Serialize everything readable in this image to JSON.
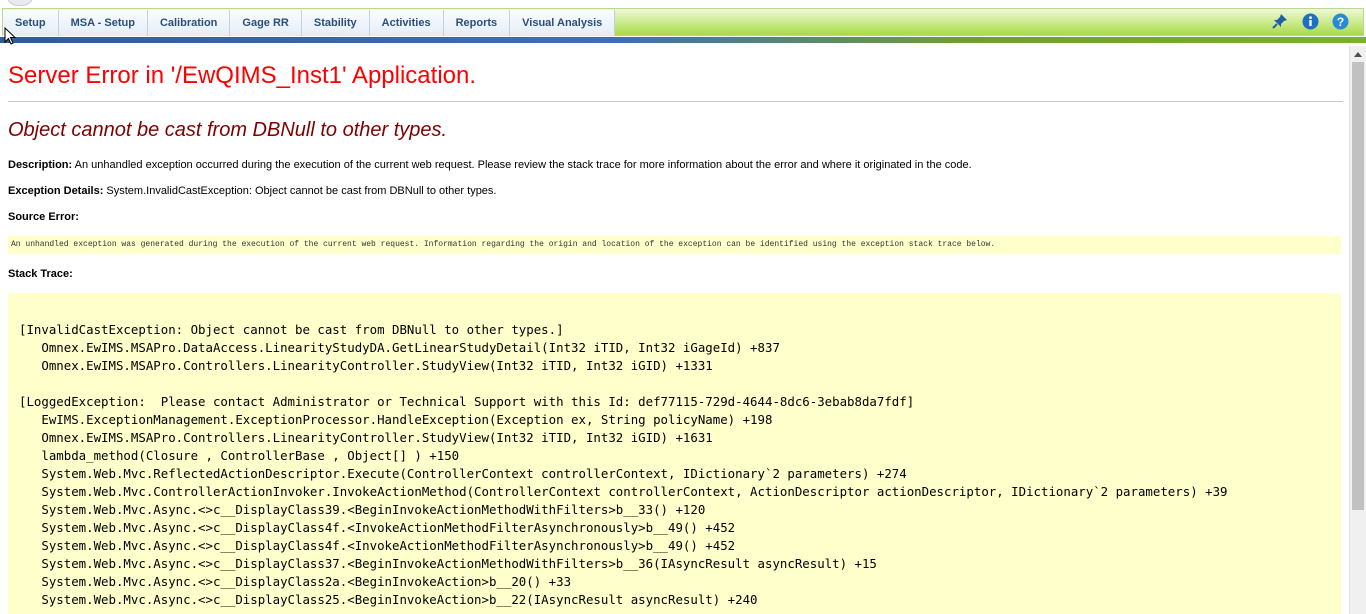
{
  "nav": {
    "tabs": [
      {
        "label": "Setup"
      },
      {
        "label": "MSA - Setup"
      },
      {
        "label": "Calibration"
      },
      {
        "label": "Gage RR"
      },
      {
        "label": "Stability"
      },
      {
        "label": "Activities"
      },
      {
        "label": "Reports"
      },
      {
        "label": "Visual Analysis"
      }
    ],
    "icons": [
      "pin-icon",
      "info-icon",
      "help-icon"
    ]
  },
  "error": {
    "title": "Server Error in '/EwQIMS_Inst1' Application.",
    "message": "Object cannot be cast from DBNull to other types.",
    "description_label": "Description:",
    "description_text": " An unhandled exception occurred during the execution of the current web request. Please review the stack trace for more information about the error and where it originated in the code.",
    "exception_label": "Exception Details:",
    "exception_text": " System.InvalidCastException: Object cannot be cast from DBNull to other types.",
    "source_error_label": "Source Error:",
    "source_error_text": "An unhandled exception was generated during the execution of the current web request. Information regarding the origin and location of the exception can be identified using the exception stack trace below.",
    "stack_trace_label": "Stack Trace:",
    "stack_trace": [
      "[InvalidCastException: Object cannot be cast from DBNull to other types.]",
      "   Omnex.EwIMS.MSAPro.DataAccess.LinearityStudyDA.GetLinearStudyDetail(Int32 iTID, Int32 iGageId) +837",
      "   Omnex.EwIMS.MSAPro.Controllers.LinearityController.StudyView(Int32 iTID, Int32 iGID) +1331",
      "",
      "[LoggedException:  Please contact Administrator or Technical Support with this Id: def77115-729d-4644-8dc6-3ebab8da7fdf]",
      "   EwIMS.ExceptionManagement.ExceptionProcessor.HandleException(Exception ex, String policyName) +198",
      "   Omnex.EwIMS.MSAPro.Controllers.LinearityController.StudyView(Int32 iTID, Int32 iGID) +1631",
      "   lambda_method(Closure , ControllerBase , Object[] ) +150",
      "   System.Web.Mvc.ReflectedActionDescriptor.Execute(ControllerContext controllerContext, IDictionary`2 parameters) +274",
      "   System.Web.Mvc.ControllerActionInvoker.InvokeActionMethod(ControllerContext controllerContext, ActionDescriptor actionDescriptor, IDictionary`2 parameters) +39",
      "   System.Web.Mvc.Async.<>c__DisplayClass39.<BeginInvokeActionMethodWithFilters>b__33() +120",
      "   System.Web.Mvc.Async.<>c__DisplayClass4f.<InvokeActionMethodFilterAsynchronously>b__49() +452",
      "   System.Web.Mvc.Async.<>c__DisplayClass4f.<InvokeActionMethodFilterAsynchronously>b__49() +452",
      "   System.Web.Mvc.Async.<>c__DisplayClass37.<BeginInvokeActionMethodWithFilters>b__36(IAsyncResult asyncResult) +15",
      "   System.Web.Mvc.Async.<>c__DisplayClass2a.<BeginInvokeAction>b__20() +33",
      "   System.Web.Mvc.Async.<>c__DisplayClass25.<BeginInvokeAction>b__22(IAsyncResult asyncResult) +240"
    ]
  },
  "colors": {
    "title": "#ff0000",
    "message": "#800000",
    "code_background": "#ffffcc",
    "nav_text": "#2b4f7a"
  }
}
